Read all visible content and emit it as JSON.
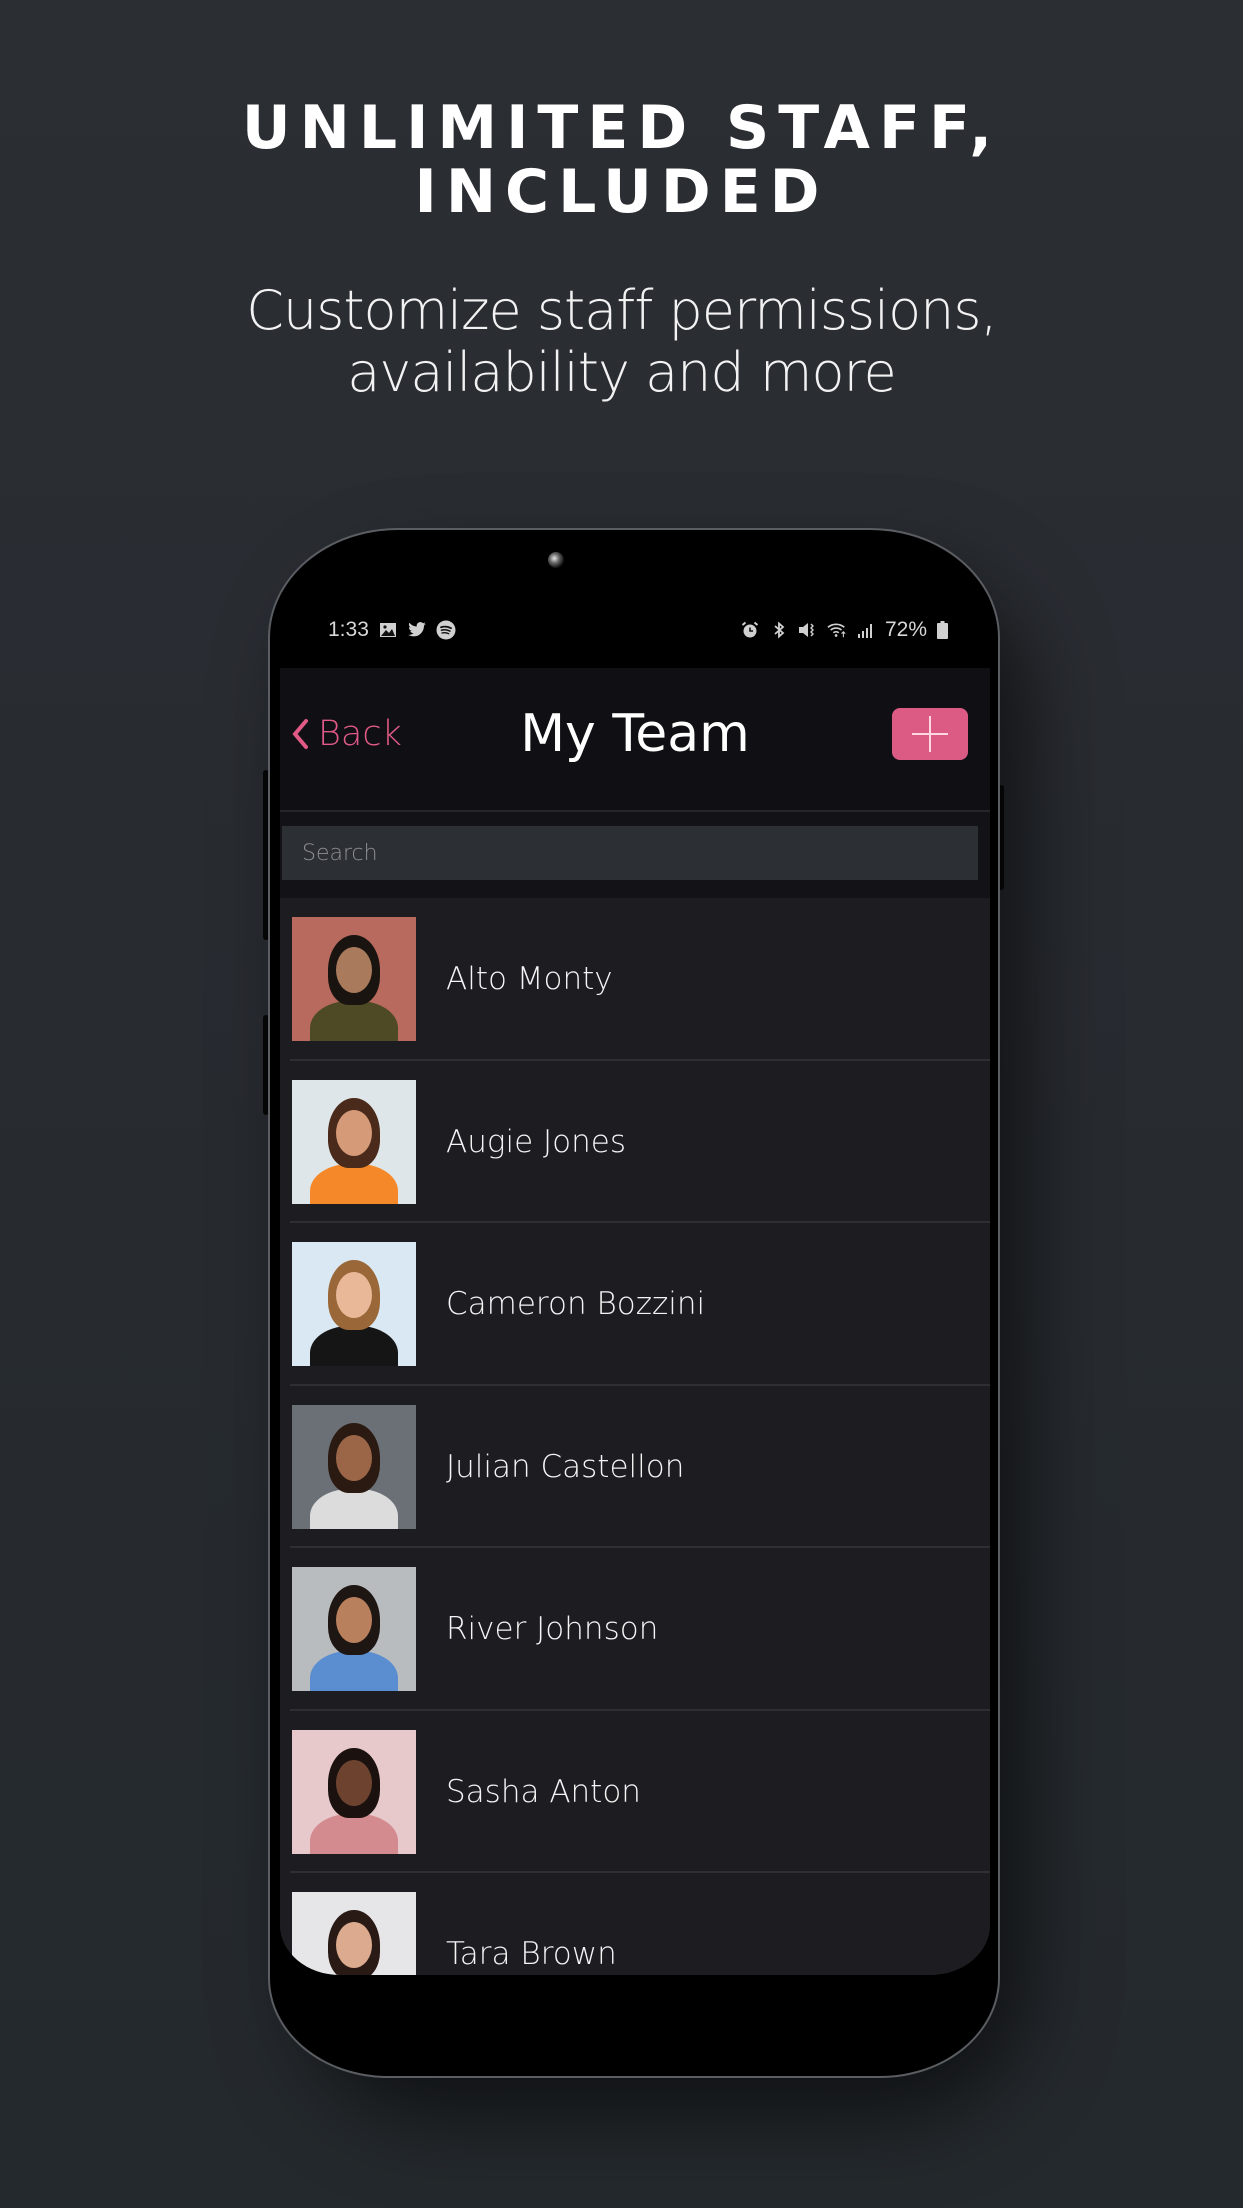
{
  "promo": {
    "headline_line1": "UNLIMITED STAFF,",
    "headline_line2": "INCLUDED",
    "subline_line1": "Customize staff permissions,",
    "subline_line2": "availability and more"
  },
  "statusbar": {
    "time": "1:33",
    "left_icons": [
      "gallery-icon",
      "twitter-icon",
      "spotify-icon"
    ],
    "right_icons": [
      "alarm-icon",
      "bluetooth-icon",
      "vibrate-mute-icon",
      "wifi-icon",
      "signal-icon"
    ],
    "battery": "72%"
  },
  "navbar": {
    "back_label": "Back",
    "title": "My Team",
    "add_icon": "plus-icon"
  },
  "search": {
    "placeholder": "Search",
    "value": ""
  },
  "colors": {
    "accent": "#dc5b85",
    "background": "#282c31",
    "list_background": "#1c1c21",
    "search_background": "#2c2f33"
  },
  "team": [
    {
      "name": "Alto Monty",
      "photo_bg": "#b86a5e",
      "skin": "#a97a5c",
      "hair": "#1a1410",
      "shirt": "#4d4a25"
    },
    {
      "name": "Augie Jones",
      "photo_bg": "#dfe6ea",
      "skin": "#d59a78",
      "hair": "#4a2a1a",
      "shirt": "#f5892a"
    },
    {
      "name": "Cameron Bozzini",
      "photo_bg": "#d9e8f3",
      "skin": "#e8b899",
      "hair": "#9a6738",
      "shirt": "#151515"
    },
    {
      "name": "Julian Castellon",
      "photo_bg": "#6b7077",
      "skin": "#9a6647",
      "hair": "#2a1a12",
      "shirt": "#dcdcdc"
    },
    {
      "name": "River Johnson",
      "photo_bg": "#b9bcbf",
      "skin": "#b9805e",
      "hair": "#1e1612",
      "shirt": "#5b8ed1"
    },
    {
      "name": "Sasha Anton",
      "photo_bg": "#e7c9cc",
      "skin": "#6d4330",
      "hair": "#1b1210",
      "shirt": "#d48b8f"
    },
    {
      "name": "Tara Brown",
      "photo_bg": "#e6e6e8",
      "skin": "#dcaa8e",
      "hair": "#2a1a15",
      "shirt": "#e86a9c"
    }
  ]
}
